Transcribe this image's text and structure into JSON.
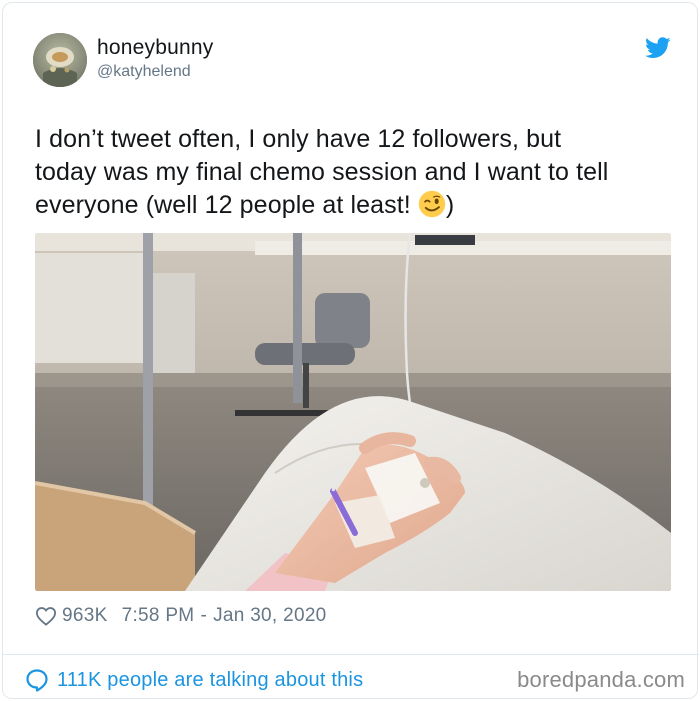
{
  "user": {
    "display_name": "honeybunny",
    "handle": "@katyhelend"
  },
  "icons": {
    "brand": "twitter-bird-icon",
    "like": "heart-icon",
    "conversation": "speech-bubble-icon",
    "emoji": "winking-face-emoji"
  },
  "tweet": {
    "text_line1": "I don’t tweet often, I only have 12 followers, but",
    "text_line2": "today was my final chemo session and I want to tell",
    "text_line3_before_emoji": "everyone (well 12 people at least! ",
    "text_line3_after_emoji": ")"
  },
  "stats": {
    "likes": "963K",
    "time": "7:58 PM",
    "separator": "-",
    "date": "Jan 30, 2020"
  },
  "footer": {
    "talking": "111K people are talking about this",
    "watermark": "boredpanda.com"
  },
  "colors": {
    "twitter_blue": "#1da1f2",
    "link_blue": "#1b95e0",
    "secondary_text": "#657786",
    "border": "#e1e8ed"
  }
}
